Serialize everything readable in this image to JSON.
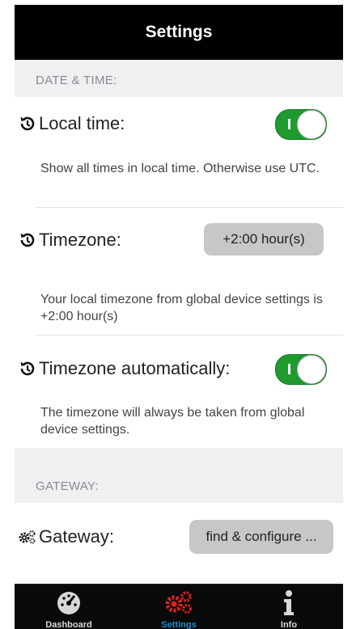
{
  "nav": {
    "title": "Settings"
  },
  "sections": {
    "date_time": {
      "header": "DATE & TIME:"
    },
    "gateway": {
      "header": "GATEWAY:"
    }
  },
  "rows": {
    "local_time": {
      "label": "Local time:",
      "icon": "history-icon",
      "toggle_on": true,
      "toggle_text": "I",
      "description": "Show all times in local time. Otherwise use UTC."
    },
    "timezone": {
      "label": "Timezone:",
      "icon": "history-icon",
      "button": "+2:00 hour(s)",
      "description": "Your local timezone from global device settings is +2:00 hour(s)"
    },
    "timezone_auto": {
      "label": "Timezone automatically:",
      "icon": "history-icon",
      "toggle_on": true,
      "toggle_text": "I",
      "description": "The timezone will always be taken from global device settings."
    },
    "gateway": {
      "label": "Gateway:",
      "icon": "gears-icon",
      "button": "find & configure ..."
    }
  },
  "tabbar": {
    "items": [
      {
        "label": "Dashboard",
        "icon": "speedometer-icon",
        "active": false
      },
      {
        "label": "Settings",
        "icon": "gears-icon",
        "active": true
      },
      {
        "label": "Info",
        "icon": "info-icon",
        "active": false
      }
    ]
  },
  "colors": {
    "toggle_on": "#1e9a2f",
    "tab_active": "#e02020",
    "tab_active_label": "#1a8ccf",
    "tab_inactive": "#d8d8d8"
  }
}
